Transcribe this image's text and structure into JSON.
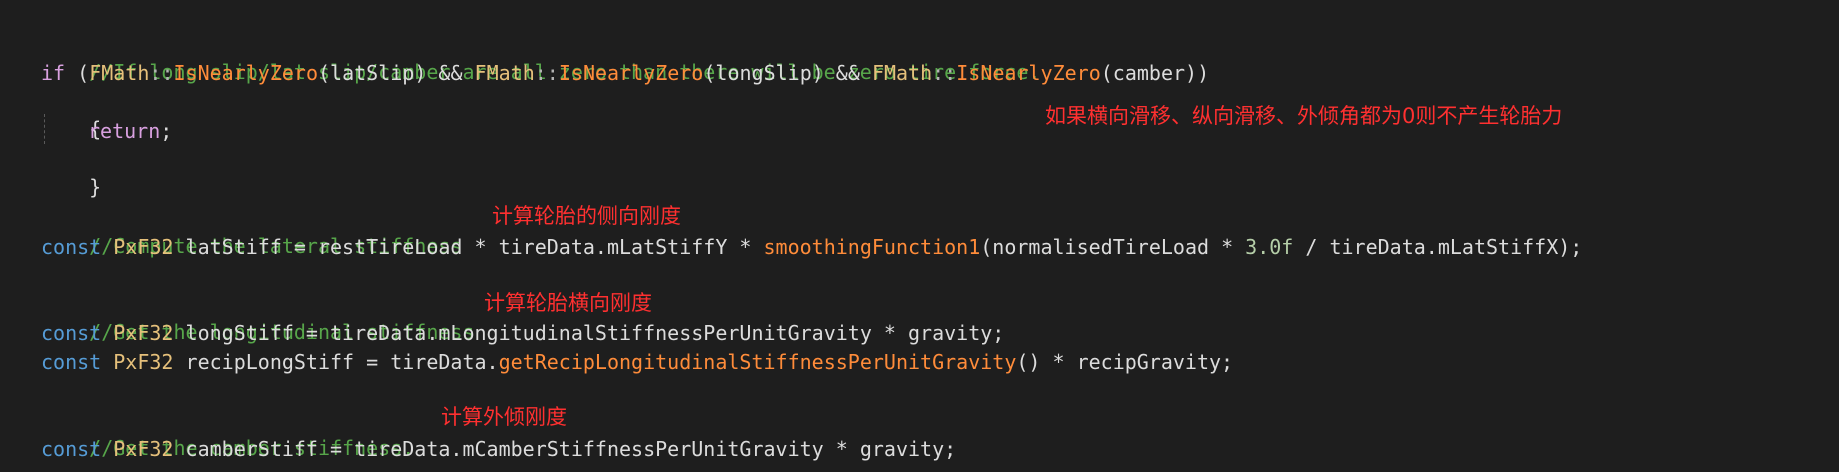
{
  "code": {
    "line1_comment": "//If long slip/lat slip/camber are all zero than there will be zero tire force.",
    "line2": {
      "kw_if": "if",
      "p1": " (",
      "type1": "FMath",
      "sep1": "::",
      "fn1": "IsNearlyZero",
      "a1": "(latSlip) && ",
      "type2": "FMath",
      "sep2": "::",
      "fn2": "IsNearlyZero",
      "a2": "(longSlip) && ",
      "type3": "FMath",
      "sep3": "::",
      "fn3": "IsNearlyZero",
      "a3": "(camber))"
    },
    "line3_brace_open": "{",
    "line4_return": "return",
    "line4_semicolon": ";",
    "line5_brace_close": "}",
    "line6_comment": "//Compute the lateral stiffness",
    "line7": {
      "kw": "const",
      "type": "PxF32",
      "rest1": " latStiff = restTireLoad * tireData.mLatStiffY * ",
      "fn": "smoothingFunction1",
      "rest2": "(normalisedTireLoad * ",
      "num": "3.0f",
      "rest3": " / tireData.mLatStiffX);"
    },
    "line8_comment": "//Get the longitudinal stiffness",
    "line9": {
      "kw": "const",
      "type": "PxF32",
      "rest": " longStiff = tireData.mLongitudinalStiffnessPerUnitGravity * gravity;"
    },
    "line10": {
      "kw": "const",
      "type": "PxF32",
      "rest1": " recipLongStiff = tireData.",
      "fn": "getRecipLongitudinalStiffnessPerUnitGravity",
      "rest2": "() * recipGravity;"
    },
    "line11_comment": "//Get the camber stiffness.",
    "line12": {
      "kw": "const",
      "type": "PxF32",
      "rest": " camberStiff = tireData.mCamberStiffnessPerUnitGravity * gravity;"
    }
  },
  "annotations": {
    "zero_force": "如果横向滑移、纵向滑移、外倾角都为0则不产生轮胎力",
    "lateral": "计算轮胎的侧向刚度",
    "longitudinal": "计算轮胎横向刚度",
    "camber": "计算外倾刚度"
  },
  "colors": {
    "background": "#1e1e1e",
    "comment": "#57a64a",
    "keyword": "#569cd6",
    "control_keyword": "#d8a0df",
    "type": "#e5c07b",
    "function": "#ff8c3a",
    "annotation": "#ff3030"
  }
}
